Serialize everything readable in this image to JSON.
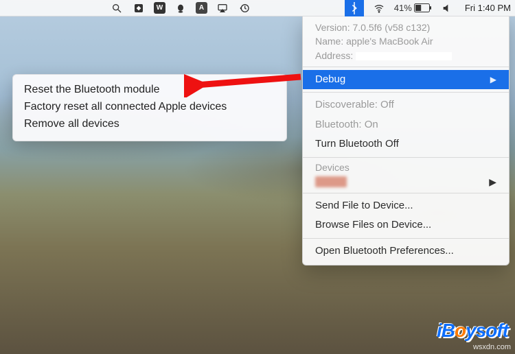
{
  "menubar": {
    "icons": {
      "spotlight": "spotlight-icon",
      "screenmirror": "screenmirror-icon",
      "wps": "W",
      "qq": "qq-icon",
      "a": "A",
      "airplay": "airplay-icon",
      "timemachine": "timemachine-icon",
      "bluetooth": "bluetooth-icon",
      "wifi": "wifi-icon",
      "speaker": "speaker-icon"
    },
    "battery_pct": "41%",
    "clock": "Fri 1:40 PM"
  },
  "dropdown": {
    "version_label": "Version:",
    "version_value": "7.0.5f6 (v58 c132)",
    "name_label": "Name:",
    "name_value": "apple's MacBook Air",
    "address_label": "Address:",
    "debug": "Debug",
    "discoverable": "Discoverable: Off",
    "bluetooth_state": "Bluetooth: On",
    "turn_off": "Turn Bluetooth Off",
    "devices_head": "Devices",
    "send_file": "Send File to Device...",
    "browse_files": "Browse Files on Device...",
    "open_prefs": "Open Bluetooth Preferences..."
  },
  "submenu": {
    "reset_module": "Reset the Bluetooth module",
    "factory_reset": "Factory reset all connected Apple devices",
    "remove_all": "Remove all devices"
  },
  "watermark": {
    "brand_prefix": "iB",
    "brand_o": "o",
    "brand_suffix": "ysoft",
    "site": "wsxdn.com"
  }
}
